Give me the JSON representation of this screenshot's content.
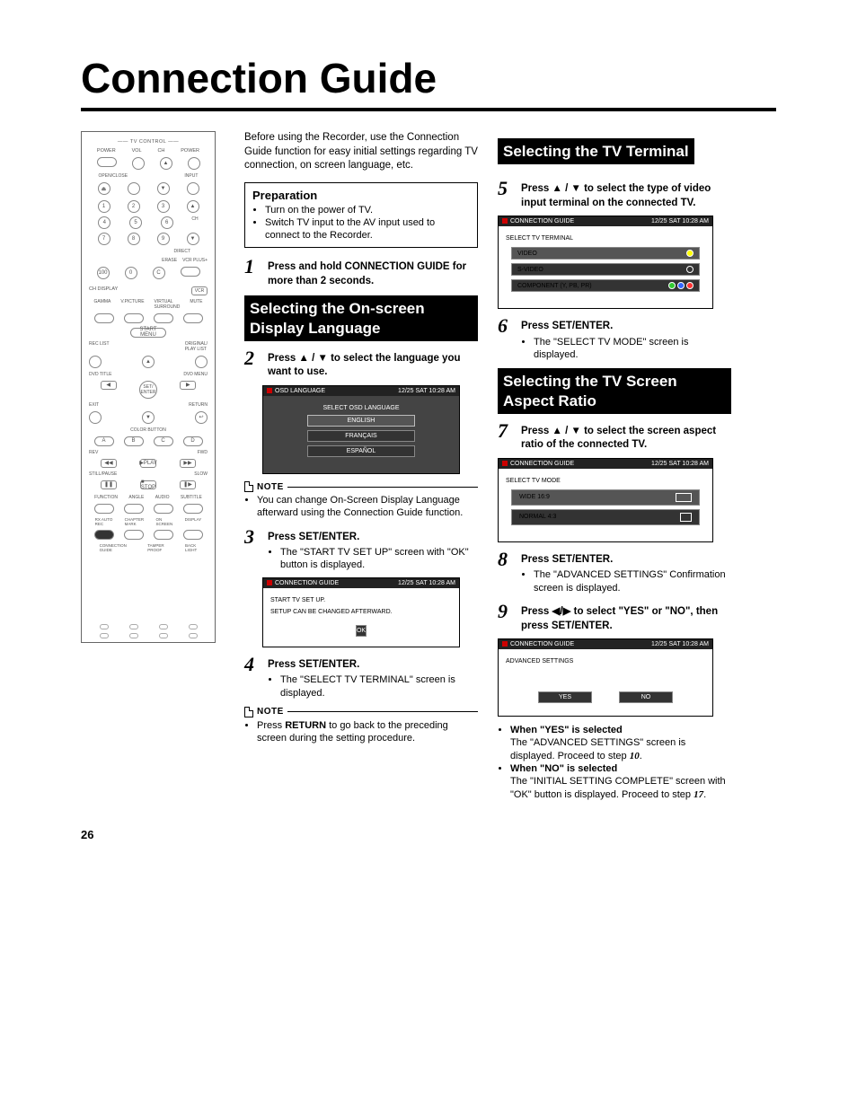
{
  "title": "Connection Guide",
  "page_number": "26",
  "intro": "Before using the Recorder, use the Connection Guide function for easy initial settings regarding TV connection, on screen language, etc.",
  "preparation": {
    "heading": "Preparation",
    "items": [
      "Turn on the power of TV.",
      "Switch TV input to the AV input used to connect to the Recorder."
    ]
  },
  "step1": {
    "pre": "Press and hold ",
    "btn": "CONNECTION GUIDE",
    "post": " for more than 2 seconds."
  },
  "heading_lang": "Selecting the On-screen Display Language",
  "step2": {
    "pre": "Press ",
    "arrows": "▲ / ▼",
    "post": " to select the language you want to use."
  },
  "screen_lang": {
    "hdr": "OSD LANGUAGE",
    "time": "12/25  SAT 10:28  AM",
    "sub": "SELECT OSD LANGUAGE",
    "opts": [
      "ENGLISH",
      "FRANÇAIS",
      "ESPAÑOL"
    ]
  },
  "note1": {
    "label": "NOTE",
    "text": "You can change On-Screen Display Language afterward using the Connection Guide function."
  },
  "step3": {
    "pre": "Press ",
    "btn": "SET/ENTER",
    "post": ".",
    "bullet": "The \"START TV SET UP\" screen with \"OK\" button is displayed."
  },
  "screen_setup": {
    "hdr": "CONNECTION GUIDE",
    "time": "12/25  SAT 10:28  AM",
    "line1": "START TV SET UP.",
    "line2": "SETUP CAN BE CHANGED AFTERWARD.",
    "ok": "OK"
  },
  "step4": {
    "pre": "Press ",
    "btn": "SET/ENTER",
    "post": ".",
    "bullet": "The \"SELECT TV TERMINAL\" screen is displayed."
  },
  "note2": {
    "label": "NOTE",
    "text_pre": "Press ",
    "text_bold": "RETURN",
    "text_post": " to go back to the preceding screen during the setting procedure."
  },
  "heading_terminal": "Selecting the TV Terminal",
  "step5": {
    "pre": "Press ",
    "arrows": "▲ / ▼",
    "post": " to select the type of video input terminal on the connected TV."
  },
  "screen_term": {
    "hdr": "CONNECTION GUIDE",
    "time": "12/25  SAT 10:28  AM",
    "sub": "SELECT TV TERMINAL",
    "rows": [
      {
        "label": "VIDEO",
        "icons": [
          "y"
        ]
      },
      {
        "label": "S-VIDEO",
        "icons": [
          "w"
        ]
      },
      {
        "label": "COMPONENT (Y, PB, PR)",
        "icons": [
          "g",
          "b",
          "r"
        ]
      }
    ]
  },
  "step6": {
    "pre": "Press ",
    "btn": "SET/ENTER",
    "post": ".",
    "bullet": "The \"SELECT TV MODE\" screen is displayed."
  },
  "heading_aspect": "Selecting the TV Screen Aspect Ratio",
  "step7": {
    "pre": "Press ",
    "arrows": "▲ / ▼",
    "post": " to select the screen aspect ratio of the connected TV."
  },
  "screen_mode": {
    "hdr": "CONNECTION GUIDE",
    "time": "12/25  SAT 10:28  AM",
    "sub": "SELECT TV MODE",
    "rows": [
      {
        "label": "WIDE 16:9",
        "shape": "wide"
      },
      {
        "label": "NORMAL 4:3",
        "shape": "norm"
      }
    ]
  },
  "step8": {
    "pre": "Press ",
    "btn": "SET/ENTER",
    "post": ".",
    "bullet": "The \"ADVANCED SETTINGS\" Confirmation screen is displayed."
  },
  "step9": {
    "pre": "Press ",
    "arrows": "◀/▶",
    "mid": " to select \"YES\" or \"NO\", then press ",
    "btn": "SET/ENTER",
    "post": "."
  },
  "screen_adv": {
    "hdr": "CONNECTION GUIDE",
    "time": "12/25  SAT 10:28  AM",
    "sub": "ADVANCED SETTINGS",
    "yes": "YES",
    "no": "NO"
  },
  "after9": {
    "yes_h": "When \"YES\" is selected",
    "yes_t1": "The \"ADVANCED SETTINGS\" screen is displayed. Proceed to step ",
    "yes_step": "10",
    "no_h": "When \"NO\" is selected",
    "no_t1": "The \"INITIAL SETTING COMPLETE\" screen with \"OK\" button is displayed. Proceed to step ",
    "no_step": "17"
  },
  "remote": {
    "tv_control": "TV CONTROL",
    "labels": [
      "POWER",
      "VOL",
      "CH",
      "POWER",
      "OPEN/CLOSE",
      "INPUT",
      "DIRECT",
      "ERASE",
      "VCR PLUS+",
      "CH",
      "CH DISPLAY",
      "VCR",
      "GAMMA",
      "V.PICTURE",
      "VIRTUAL SURROUND",
      "MUTE",
      "START MENU",
      "REC LIST",
      "ORIGINAL/PLAY LIST",
      "DVD TITLE",
      "DVD MENU",
      "SET/ENTER",
      "EXIT",
      "RETURN",
      "COLOR BUTTON",
      "REV",
      "FWD",
      "PLAY",
      "STILL/PAUSE",
      "SLOW",
      "STOP",
      "FUNCTION",
      "ANGLE",
      "AUDIO",
      "SUBTITLE",
      "RX AUTO REC",
      "CHAPTER MARK",
      "ON SCREEN",
      "DISPLAY",
      "CONNECTION GUIDE",
      "TAMPER PROOF",
      "BACK LIGHT"
    ]
  }
}
